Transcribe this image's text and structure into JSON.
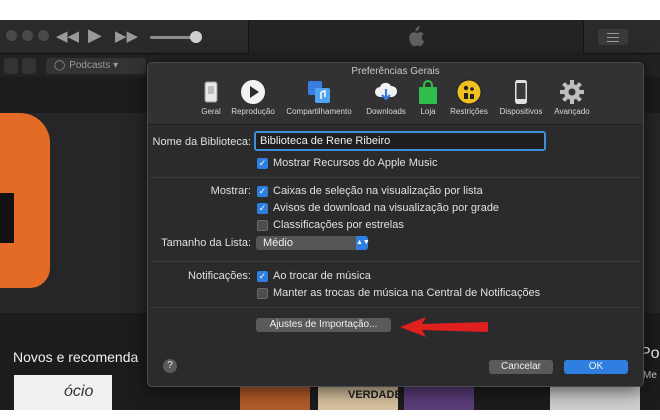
{
  "itunes": {
    "nav": {
      "podcasts_label": "Podcasts"
    },
    "section_title": "Novos e recomenda",
    "right_cut_text": "Po",
    "right_cut_text2": "Me",
    "tile_text": "ócio",
    "tile_text2": "VERDADES"
  },
  "dialog": {
    "title": "Preferências Gerais",
    "toolbar": [
      {
        "label": "Geral",
        "icon": "switch-icon",
        "selected": true
      },
      {
        "label": "Reprodução",
        "icon": "play-icon"
      },
      {
        "label": "Compartilhamento",
        "icon": "sharing-icon"
      },
      {
        "label": "Downloads",
        "icon": "cloud-download-icon"
      },
      {
        "label": "Loja",
        "icon": "store-bag-icon"
      },
      {
        "label": "Restrições",
        "icon": "parental-icon"
      },
      {
        "label": "Dispositivos",
        "icon": "iphone-icon"
      },
      {
        "label": "Avançado",
        "icon": "gear-icon"
      }
    ],
    "library_name_label": "Nome da Biblioteca:",
    "library_name_value": "Biblioteca de Rene Ribeiro",
    "apple_music_label": "Mostrar Recursos do Apple Music",
    "show_label": "Mostrar:",
    "show_options": [
      {
        "label": "Caixas de seleção na visualização por lista",
        "checked": true
      },
      {
        "label": "Avisos de download na visualização por grade",
        "checked": true
      },
      {
        "label": "Classificações por estrelas",
        "checked": false
      }
    ],
    "list_size_label": "Tamanho da Lista:",
    "list_size_value": "Médio",
    "notifications_label": "Notificações:",
    "notification_options": [
      {
        "label": "Ao trocar de música",
        "checked": true
      },
      {
        "label": "Manter as trocas de música na Central de Notificações",
        "checked": false
      }
    ],
    "import_button": "Ajustes de Importação...",
    "help_label": "?",
    "cancel_button": "Cancelar",
    "ok_button": "OK"
  },
  "colors": {
    "accent": "#2f7fe0",
    "annotation_arrow": "#e0201c",
    "hero_orange": "#e46b26"
  }
}
